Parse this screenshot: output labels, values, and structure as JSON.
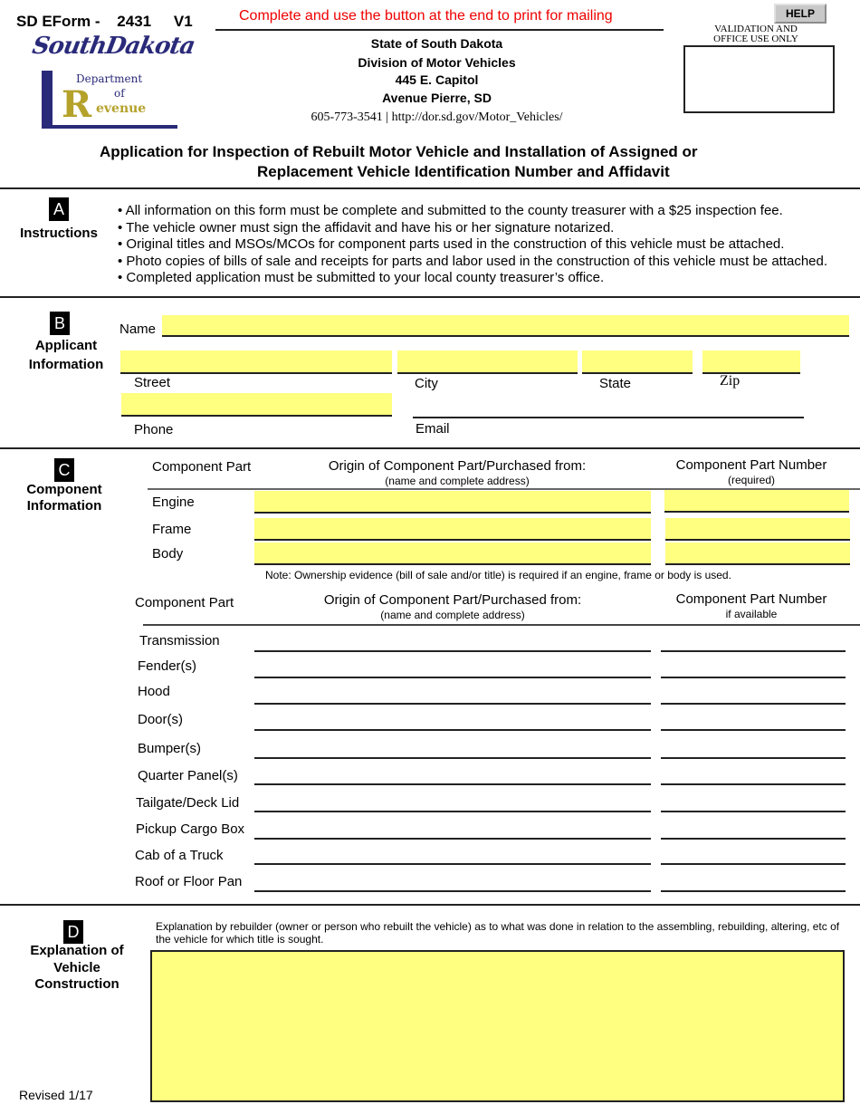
{
  "header": {
    "form_id": "SD EForm -",
    "form_number": "2431",
    "version": "V1",
    "print_notice": "Complete and use the button at the end to print for mailing",
    "help_button": "HELP",
    "validation_label_1": "VALIDATION AND",
    "validation_label_2": "OFFICE USE ONLY",
    "logo": {
      "script_text": "SouthDakota",
      "dept_line1": "Department",
      "dept_line2": "of",
      "dept_line3": "evenue",
      "dept_initial": "R"
    },
    "agency": {
      "line1": "State of South Dakota",
      "line2": "Division of Motor Vehicles",
      "line3": "445 E. Capitol",
      "line4": "Avenue Pierre, SD",
      "contact": "605-773-3541 | http://dor.sd.gov/Motor_Vehicles/"
    },
    "title_line1": "Application for Inspection of Rebuilt Motor Vehicle and Installation of Assigned or",
    "title_line2": "Replacement Vehicle Identification Number and Affidavit"
  },
  "sections": {
    "a": {
      "badge": "A",
      "label": "Instructions",
      "items": [
        "• All information on this form must be complete and submitted to the county treasurer with a $25 inspection fee.",
        "• The vehicle owner must sign the affidavit and have his or her signature notarized.",
        "• Original titles and MSOs/MCOs for component parts used in the construction of this vehicle must be attached.",
        "• Photo copies of bills of sale and receipts for parts and labor used in the construction of this vehicle must be attached.",
        "• Completed application must be submitted to your local county treasurer’s office."
      ]
    },
    "b": {
      "badge": "B",
      "label_1": "Applicant",
      "label_2": "Information",
      "name_label": "Name",
      "street_label": "Street",
      "city_label": "City",
      "state_label": "State",
      "zip_label": "Zip",
      "phone_label": "Phone",
      "email_label": "Email",
      "values": {
        "name": "",
        "street": "",
        "city": "",
        "state": "",
        "zip": "",
        "phone": "",
        "email": ""
      }
    },
    "c": {
      "badge": "C",
      "label_1": "Component",
      "label_2": "Information",
      "table1": {
        "col1": "Component Part",
        "col2": "Origin of Component Part/Purchased from:",
        "col2_sub": "(name and complete address)",
        "col3": "Component Part Number",
        "col3_sub": "(required)",
        "rows": [
          "Engine",
          "Frame",
          "Body"
        ]
      },
      "note": "Note: Ownership evidence (bill of sale and/or title) is required if an engine, frame or body is used.",
      "table2": {
        "col1": "Component Part",
        "col2": "Origin of Component Part/Purchased from:",
        "col2_sub": "(name and complete address)",
        "col3": "Component Part Number",
        "col3_sub": "if available",
        "rows": [
          "Transmission",
          "Fender(s)",
          "Hood",
          "Door(s)",
          "Bumper(s)",
          "Quarter Panel(s)",
          "Tailgate/Deck Lid",
          "Pickup Cargo Box",
          "Cab of a Truck",
          "Roof or Floor Pan"
        ]
      }
    },
    "d": {
      "badge": "D",
      "label_1": "Explanation of",
      "label_2": "Vehicle",
      "label_3": "Construction",
      "prompt": "Explanation by rebuilder (owner or person who rebuilt the vehicle) as to what was done in relation to the assembling, rebuilding, altering, etc of the vehicle for which title is sought.",
      "value": ""
    }
  },
  "footer": {
    "revised": "Revised 1/17"
  }
}
